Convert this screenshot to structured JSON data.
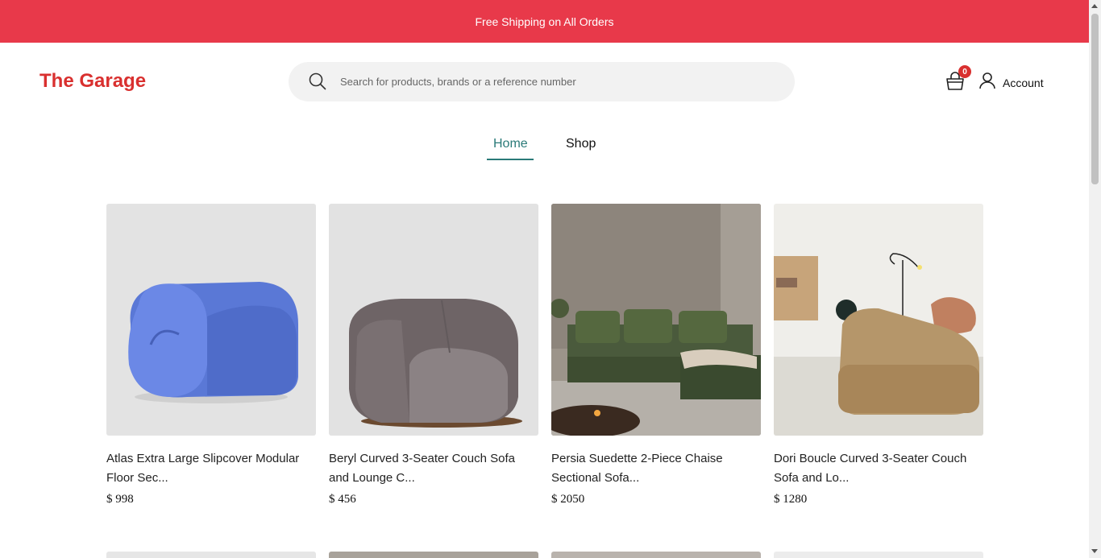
{
  "promo": {
    "text": "Free Shipping on All Orders"
  },
  "header": {
    "logo": "The Garage",
    "search_placeholder": "Search for products, brands or a reference number",
    "cart_count": "0",
    "account_label": "Account"
  },
  "nav": {
    "tabs": [
      {
        "label": "Home",
        "active": true
      },
      {
        "label": "Shop",
        "active": false
      }
    ]
  },
  "products": [
    {
      "name": "Atlas Extra Large Slipcover Modular Floor Sec...",
      "price": "$ 998"
    },
    {
      "name": "Beryl Curved 3-Seater Couch Sofa and Lounge C...",
      "price": "$ 456"
    },
    {
      "name": "Persia Suedette 2-Piece Chaise Sectional Sofa...",
      "price": "$ 2050"
    },
    {
      "name": "Dori Boucle Curved 3-Seater Couch Sofa and Lo...",
      "price": "$ 1280"
    }
  ],
  "colors": {
    "promo_bg": "#e8394a",
    "brand": "#d9302f",
    "accent": "#2a7a78"
  }
}
